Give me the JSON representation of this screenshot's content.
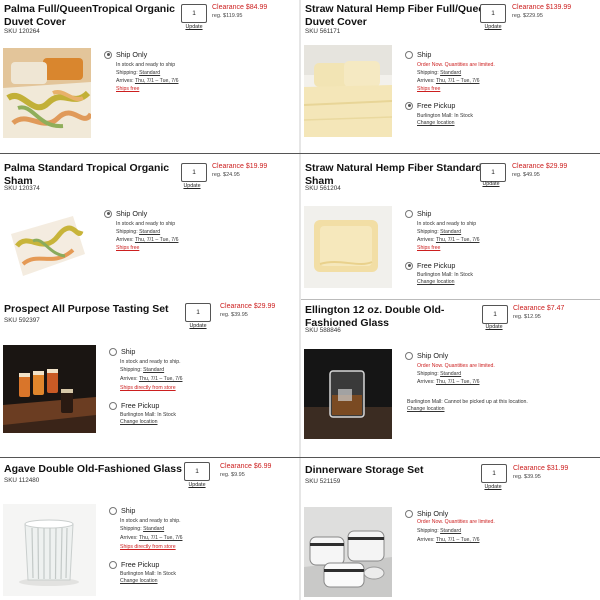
{
  "cards": [
    {
      "title_l1": "Palma Full/QueenTropical Organic",
      "title_l2": "Duvet Cover",
      "sku": "SKU 120264",
      "qty": "1",
      "update": "Update",
      "clearance": "Clearance $84.99",
      "reg": "reg. $119.95",
      "ship_label": "Ship Only",
      "ship_status": "In stock and ready to ship",
      "shipping_prefix": "Shipping: ",
      "shipping_method": "Standard",
      "arrives_prefix": "Arrives: ",
      "arrives_dates": "Thu, 7/1 – Tue, 7/6",
      "ships_note": "Ships free"
    },
    {
      "title_l1": "Straw Natural Hemp Fiber Full/Queen",
      "title_l2": "Duvet Cover",
      "sku": "SKU 561171",
      "qty": "1",
      "update": "Update",
      "clearance": "Clearance $139.99",
      "reg": "reg. $229.95",
      "ship_label": "Ship",
      "ship_status": "Order Now. Quantities are limited.",
      "shipping_prefix": "Shipping: ",
      "shipping_method": "Standard",
      "arrives_prefix": "Arrives: ",
      "arrives_dates": "Thu, 7/1 – Tue, 7/6",
      "ships_note": "Ships free",
      "pickup_label": "Free Pickup",
      "pickup_status": "Burlington Mall: In Stock",
      "change_location": "Change location"
    },
    {
      "title_l1": "Palma Standard Tropical Organic",
      "title_l2": "Sham",
      "sku": "SKU 120374",
      "qty": "1",
      "update": "Update",
      "clearance": "Clearance $19.99",
      "reg": "reg. $24.95",
      "ship_label": "Ship Only",
      "ship_status": "In stock and ready to ship",
      "shipping_prefix": "Shipping: ",
      "shipping_method": "Standard",
      "arrives_prefix": "Arrives: ",
      "arrives_dates": "Thu, 7/1 – Tue, 7/6",
      "ships_note": "Ships free"
    },
    {
      "title_l1": "Straw Natural Hemp Fiber Standard",
      "title_l2": "Sham",
      "sku": "SKU 561204",
      "qty": "1",
      "update": "Update",
      "clearance": "Clearance $29.99",
      "reg": "reg. $49.95",
      "ship_label": "Ship",
      "ship_status": "In stock and ready to ship",
      "shipping_prefix": "Shipping: ",
      "shipping_method": "Standard",
      "arrives_prefix": "Arrives: ",
      "arrives_dates": "Thu, 7/1 – Tue, 7/6",
      "ships_note": "Ships free",
      "pickup_label": "Free Pickup",
      "pickup_status": "Burlington Mall: In Stock",
      "change_location": "Change location"
    },
    {
      "title_l1": "Prospect All Purpose Tasting Set",
      "sku": "SKU 592397",
      "qty": "1",
      "update": "Update",
      "clearance": "Clearance $29.99",
      "reg": "reg. $39.95",
      "ship_label": "Ship",
      "ship_status": "In stock and ready to ship.",
      "shipping_prefix": "Shipping: ",
      "shipping_method": "Standard",
      "arrives_prefix": "Arrives: ",
      "arrives_dates": "Thu, 7/1 – Tue, 7/6",
      "ships_note": "Ships directly from store",
      "pickup_label": "Free Pickup",
      "pickup_status": "Burlington Mall: In Stock",
      "change_location": "Change location"
    },
    {
      "title_l1": "Ellington 12 oz. Double Old-",
      "title_l2": "Fashioned Glass",
      "sku": "SKU 588846",
      "qty": "1",
      "update": "Update",
      "clearance": "Clearance $7.47",
      "reg": "reg. $12.95",
      "ship_label": "Ship Only",
      "ship_status": "Order Now. Quantities are limited.",
      "shipping_prefix": "Shipping: ",
      "shipping_method": "Standard",
      "arrives_prefix": "Arrives: ",
      "arrives_dates": "Thu, 7/1 – Tue, 7/6",
      "pickup_status": "Burlington Mall: Cannot be picked up at this location.",
      "change_location": "Change location"
    },
    {
      "title_l1": "Agave Double Old-Fashioned Glass",
      "sku": "SKU 112480",
      "qty": "1",
      "update": "Update",
      "clearance": "Clearance $6.99",
      "reg": "reg. $9.95",
      "ship_label": "Ship",
      "ship_status": "In stock and ready to ship.",
      "shipping_prefix": "Shipping: ",
      "shipping_method": "Standard",
      "arrives_prefix": "Arrives: ",
      "arrives_dates": "Thu, 7/1 – Tue, 7/6",
      "ships_note": "Ships directly from store",
      "pickup_label": "Free Pickup",
      "pickup_status": "Burlington Mall: In Stock",
      "change_location": "Change location"
    },
    {
      "title_l1": "Dinnerware Storage Set",
      "sku": "SKU 521159",
      "qty": "1",
      "update": "Update",
      "clearance": "Clearance $31.99",
      "reg": "reg. $39.95",
      "ship_label": "Ship Only",
      "ship_status": "Order Now. Quantities are limited.",
      "shipping_prefix": "Shipping: ",
      "shipping_method": "Standard",
      "arrives_prefix": "Arrives: ",
      "arrives_dates": "Thu, 7/1 – Tue, 7/6"
    }
  ],
  "colors": {
    "sale_red": "#cc1f1f",
    "divider": "#555555"
  }
}
